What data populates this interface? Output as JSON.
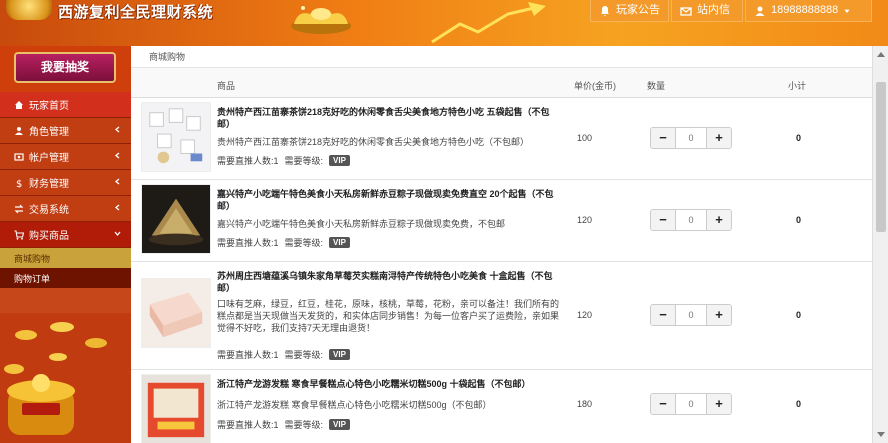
{
  "header": {
    "app_title": "西游复利全民理财系统",
    "notice_label": "玩家公告",
    "mail_label": "站内信",
    "user_label": "18988888888"
  },
  "sidebar": {
    "lottery_label": "我要抽奖",
    "items": [
      {
        "label": "玩家首页",
        "icon": "home-icon"
      },
      {
        "label": "角色管理",
        "icon": "user-icon"
      },
      {
        "label": "帐户管理",
        "icon": "account-icon"
      },
      {
        "label": "财务管理",
        "icon": "dollar-icon"
      },
      {
        "label": "交易系统",
        "icon": "exchange-icon"
      },
      {
        "label": "购买商品",
        "icon": "cart-icon"
      }
    ],
    "sub_items": [
      {
        "label": "商城购物"
      },
      {
        "label": "购物订单"
      }
    ]
  },
  "main": {
    "breadcrumb": "商城购物",
    "columns": {
      "product": "商品",
      "unit_price": "单价(金币)",
      "quantity": "数量",
      "subtotal": "小计"
    },
    "quantity_placeholder": "0",
    "minus_label": "−",
    "plus_label": "+",
    "products": [
      {
        "title": "贵州特产西江苗寨茶饼218克好吃的休闲零食舌尖美食地方特色小吃 五袋起售（不包邮）",
        "desc": "贵州特产西江苗寨茶饼218克好吃的休闲零食舌尖美食地方特色小吃（不包邮）",
        "referrals": "需要直推人数:1",
        "level_label": "需要等级:",
        "level": "VIP",
        "price": "100",
        "subtotal": "0"
      },
      {
        "title": "嘉兴特产小吃端午特色美食小天私房新鲜赤豆粽子现做现卖免费直空 20个起售（不包邮）",
        "desc": "嘉兴特产小吃端午特色美食小天私房新鲜赤豆粽子现做现卖免费，不包邮",
        "referrals": "需要直推人数:1",
        "level_label": "需要等级:",
        "level": "VIP",
        "price": "120",
        "subtotal": "0"
      },
      {
        "title": "苏州周庄西塘蕴溪乌镇朱家角草莓芡实糕南浔特产传统特色小吃美食 十盒起售（不包邮）",
        "desc": "口味有芝麻，绿豆，红豆，桂花，原味，核桃，草莓，花粉，亲可以备注！我们所有的糕点都是当天现做当天发货的，和实体店同步销售！为每一位客户买了运费险，亲如果觉得不好吃，我们支持7天无理由退货！",
        "referrals": "需要直推人数:1",
        "level_label": "需要等级:",
        "level": "VIP",
        "price": "120",
        "subtotal": "0"
      },
      {
        "title": "浙江特产龙游发糕 寒食早餐糕点心特色小吃糯米切糕500g 十袋起售（不包邮）",
        "desc": "浙江特产龙游发糕 寒食早餐糕点心特色小吃糯米切糕500g（不包邮）",
        "referrals": "需要直推人数:1",
        "level_label": "需要等级:",
        "level": "VIP",
        "price": "180",
        "subtotal": "0"
      }
    ]
  },
  "colors": {
    "header_orange": "#f07e14",
    "sidebar_red": "#c6481a",
    "active_gold": "#c9a23c",
    "vip_badge": "#555555"
  }
}
